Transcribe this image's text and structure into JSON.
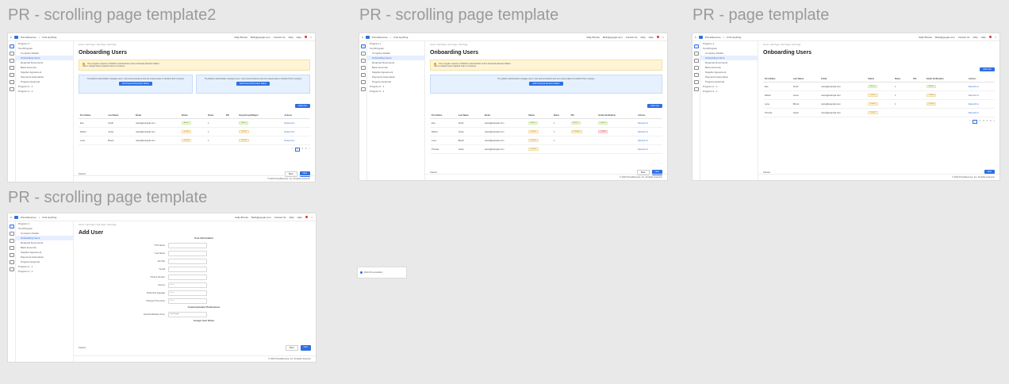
{
  "frames": {
    "f1": {
      "title": "PR - scrolling page template2",
      "page_title": "Onboarding Users",
      "banner": "Your program requires a Platform Administrator and a Financial Decision Maker.",
      "banner_sub": "Add or assign these required roles to continue.",
      "info_left": "The platform administrator manages users, roles and permissions and can request tasks on behalf of their company.",
      "info_right": "The platform administrator manages users, roles and permissions and can request tasks on behalf of their company.",
      "btn_left": "Add Financial Decision Maker",
      "btn_right": "Add Financial Decision Maker",
      "add_user": "Add User",
      "columns": [
        "First Name",
        "Last Name",
        "Email",
        "Status",
        "Notes",
        "PAI",
        "Deny/Accept/Reject",
        "Actions"
      ],
      "rows": [
        [
          "Eva",
          "Smith",
          "name@example.com",
          "Active",
          "1",
          "",
          "Active",
          "Resend inv"
        ],
        [
          "Robert",
          "Jones",
          "name@example.com",
          "Invited",
          "1",
          "",
          "Invited",
          "Resend inv"
        ],
        [
          "Lena",
          "Brown",
          "name@example.com",
          "Invited",
          "1",
          "",
          "Invited",
          "Resend inv"
        ]
      ],
      "pager": [
        "<",
        "1",
        "2",
        "3",
        ">"
      ],
      "cancel": "Cancel",
      "back": "Back",
      "next": "Next",
      "copyright": "© 2024 PrimeRevenue, Inc. All rights reserved."
    },
    "f2": {
      "title": "PR - scrolling page template",
      "page_title": "Onboarding Users",
      "banner": "Your program requires a Platform Administrator and a Financial Decision Maker.",
      "banner_sub": "Add or assign these required roles to continue.",
      "info": "The platform administrator manages users, roles and permissions and can request tasks on behalf of their company.",
      "btn": "Add Financial Decision Maker",
      "add_user": "Add User",
      "columns": [
        "First Name",
        "Last Name",
        "Email",
        "Status",
        "Notes",
        "PAI",
        "Email Verification",
        "Actions"
      ],
      "rows": [
        [
          "Eva",
          "Smith",
          "name@example.com",
          "Active",
          "1",
          "Active",
          "Active",
          "Resend inv"
        ],
        [
          "Robert",
          "Jones",
          "name@example.com",
          "Invited",
          "1",
          "Pending",
          "Failed",
          "Resend inv"
        ],
        [
          "Lena",
          "Brown",
          "name@example.com",
          "Invited",
          "1",
          "",
          "",
          "Resend inv"
        ],
        [
          "Thomas",
          "Green",
          "name@example.com",
          "Invited",
          "",
          "",
          "",
          "Resend inv"
        ]
      ],
      "cancel": "Cancel",
      "back": "Back",
      "next": "Next",
      "copyright": "© 2024 PrimeRevenue, Inc. All rights reserved."
    },
    "f3": {
      "title": "PR - page template",
      "page_title": "Onboarding Users",
      "add_user": "Add User",
      "columns": [
        "First Name",
        "Last Name",
        "Email",
        "Status",
        "Notes",
        "PAI",
        "Email Verification",
        "Actions"
      ],
      "rows": [
        [
          "Eva",
          "Smith",
          "name@example.com",
          "Active",
          "1",
          "",
          "Active",
          "Resend inv"
        ],
        [
          "Robert",
          "Jones",
          "name@example.com",
          "Invited",
          "1",
          "",
          "Invited",
          "Resend inv"
        ],
        [
          "Lena",
          "Brown",
          "name@example.com",
          "Invited",
          "1",
          "",
          "Invited",
          "Resend inv"
        ],
        [
          "Thomas",
          "Green",
          "name@example.com",
          "Invited",
          "",
          "",
          "",
          "Resend inv"
        ]
      ],
      "pager": [
        "<",
        "1",
        "2",
        "3",
        "4",
        "5",
        ">"
      ],
      "cancel": "Cancel",
      "next": "Next",
      "copyright": "© 2024 PrimeRevenue, Inc. All rights reserved."
    },
    "f4": {
      "title": "PR - scrolling page template",
      "page_title": "Add User",
      "section_user": "User Information",
      "fields": [
        {
          "label": "* First Name",
          "value": ""
        },
        {
          "label": "* Last Name",
          "value": ""
        },
        {
          "label": "Job Title",
          "value": ""
        },
        {
          "label": "* Email",
          "value": ""
        },
        {
          "label": "* Phone Number",
          "value": ""
        },
        {
          "label": "Country",
          "value": "Select"
        },
        {
          "label": "Preferred Language",
          "value": "Select"
        },
        {
          "label": "Preferred Time Zone",
          "value": "Select"
        }
      ],
      "section_comm": "Communication Preferences",
      "notif_label": "Email Notification Freq.",
      "notif_value": "Low Priority",
      "section_roles": "Assign User Roles",
      "cancel": "Cancel",
      "back": "Back",
      "next": "Next",
      "copyright": "© 2024 PrimeRevenue, Inc. All rights reserved."
    }
  },
  "shell": {
    "brand": "PrimeRevenue",
    "search": "Find anything",
    "top_links": [
      "Sally Brooks",
      "Beth@google.com",
      "Contact Us",
      "FAQ",
      "Help"
    ],
    "crumbs": "Home / Sub Page / Sub Page / Sub Page",
    "nav": [
      {
        "label": "Program 1",
        "top": true
      },
      {
        "label": "Tour/Program",
        "top": true
      },
      {
        "label": "Company Details",
        "top": false
      },
      {
        "label": "Onboarding Users",
        "top": false,
        "selected": true
      },
      {
        "label": "Required Documents",
        "top": false
      },
      {
        "label": "Bank Accounts",
        "top": false
      },
      {
        "label": "Supplier Agreement",
        "top": false
      },
      {
        "label": "Payments Automation",
        "top": false
      },
      {
        "label": "Program Approval",
        "top": false
      },
      {
        "label": "Program 2 - 1",
        "top": true
      },
      {
        "label": "Program 3 - 1",
        "top": true
      }
    ]
  },
  "stray": {
    "label": "Field info annotation"
  }
}
